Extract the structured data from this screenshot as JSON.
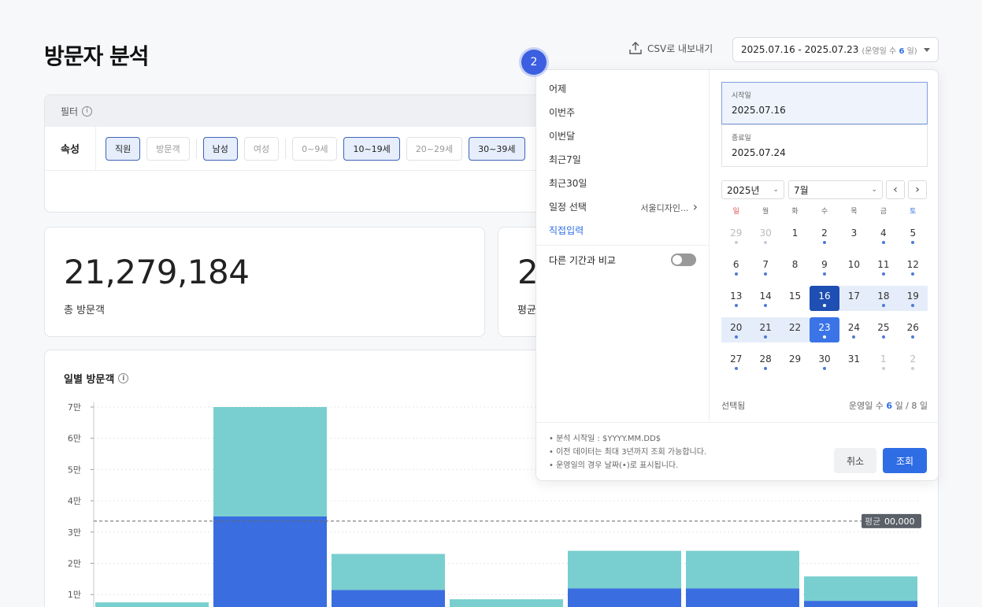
{
  "header": {
    "title": "방문자 분석",
    "csv_label": "CSV로 내보내기",
    "date_range": "2025.07.16 - 2025.07.23",
    "op_days_prefix": "(운영일 수",
    "op_days": "6",
    "op_days_suffix": "일)"
  },
  "filter": {
    "title": "필터",
    "attr_label": "속성",
    "chips": [
      {
        "label": "직원",
        "selected": true
      },
      {
        "label": "방문객",
        "selected": false
      },
      {
        "label": "남성",
        "selected": true
      },
      {
        "label": "여성",
        "selected": false
      },
      {
        "label": "0~9세",
        "selected": false
      },
      {
        "label": "10~19세",
        "selected": true
      },
      {
        "label": "20~29세",
        "selected": false
      },
      {
        "label": "30~39세",
        "selected": true
      }
    ]
  },
  "stats": [
    {
      "value": "21,279,184",
      "label": "총 방문객"
    },
    {
      "value": "2",
      "label": "평균"
    }
  ],
  "chart_title": "일별 방문객",
  "chart_data": {
    "type": "bar",
    "stacked": true,
    "y_ticks": [
      "7만",
      "6만",
      "5만",
      "4만",
      "3만",
      "2만",
      "1만"
    ],
    "ylim": [
      0,
      70000
    ],
    "series": [
      {
        "values": [
          3500,
          35000,
          11500,
          3000,
          12000,
          12000,
          8000
        ],
        "color": "#3a6ee0"
      },
      {
        "values": [
          4000,
          35000,
          11500,
          5500,
          12000,
          12000,
          7800
        ],
        "color": "#79cfcf"
      }
    ],
    "average_label": "평균",
    "average_value": "00,000",
    "average": 33500,
    "grid": true
  },
  "popover": {
    "presets": [
      {
        "label": "어제",
        "active": false,
        "right": ""
      },
      {
        "label": "이번주",
        "active": false,
        "right": ""
      },
      {
        "label": "이번달",
        "active": false,
        "right": ""
      },
      {
        "label": "최근7일",
        "active": false,
        "right": ""
      },
      {
        "label": "최근30일",
        "active": false,
        "right": ""
      },
      {
        "label": "일정 선택",
        "active": false,
        "right": "서울디자인..."
      },
      {
        "label": "직접입력",
        "active": true,
        "right": ""
      }
    ],
    "compare_label": "다른 기간과 비교",
    "start_label": "시작일",
    "start_value": "2025.07.16",
    "end_label": "종료일",
    "end_value": "2025.07.24",
    "year": "2025년",
    "month": "7월",
    "weekdays": [
      "일",
      "월",
      "화",
      "수",
      "목",
      "금",
      "토"
    ],
    "weeks": [
      [
        {
          "d": "29",
          "dot": 1,
          "m": 1
        },
        {
          "d": "30",
          "dot": 1,
          "m": 1
        },
        {
          "d": "1",
          "dot": 0
        },
        {
          "d": "2",
          "dot": 1
        },
        {
          "d": "3",
          "dot": 0
        },
        {
          "d": "4",
          "dot": 1
        },
        {
          "d": "5",
          "dot": 1
        }
      ],
      [
        {
          "d": "6",
          "dot": 1
        },
        {
          "d": "7",
          "dot": 1
        },
        {
          "d": "8",
          "dot": 0
        },
        {
          "d": "9",
          "dot": 1
        },
        {
          "d": "10",
          "dot": 0
        },
        {
          "d": "11",
          "dot": 1
        },
        {
          "d": "12",
          "dot": 1
        }
      ],
      [
        {
          "d": "13",
          "dot": 1
        },
        {
          "d": "14",
          "dot": 1
        },
        {
          "d": "15",
          "dot": 0
        },
        {
          "d": "16",
          "dot": 1,
          "s": "start"
        },
        {
          "d": "17",
          "dot": 0,
          "s": "range"
        },
        {
          "d": "18",
          "dot": 1,
          "s": "range"
        },
        {
          "d": "19",
          "dot": 1,
          "s": "range"
        }
      ],
      [
        {
          "d": "20",
          "dot": 1,
          "s": "range"
        },
        {
          "d": "21",
          "dot": 1,
          "s": "range"
        },
        {
          "d": "22",
          "dot": 0,
          "s": "range"
        },
        {
          "d": "23",
          "dot": 1,
          "s": "end"
        },
        {
          "d": "24",
          "dot": 1
        },
        {
          "d": "25",
          "dot": 1
        },
        {
          "d": "26",
          "dot": 1
        }
      ],
      [
        {
          "d": "27",
          "dot": 1
        },
        {
          "d": "28",
          "dot": 1
        },
        {
          "d": "29",
          "dot": 0
        },
        {
          "d": "30",
          "dot": 1
        },
        {
          "d": "31",
          "dot": 0
        },
        {
          "d": "1",
          "dot": 1,
          "muted": 1
        },
        {
          "d": "2",
          "dot": 1,
          "muted": 1
        }
      ]
    ],
    "selected_label": "선택됨",
    "footer_prefix": "운영일 수",
    "footer_days": "6",
    "footer_suffix": "일 / 8 일",
    "notes": [
      "• 분석 시작일 : $YYYY.MM.DD$",
      "• 이전 데이터는 최대 3년까지 조회 가능합니다.",
      "• 운영일의 경우 날짜(•)로 표시됩니다."
    ],
    "cancel_label": "취소",
    "confirm_label": "조회"
  },
  "step_badge": "2"
}
